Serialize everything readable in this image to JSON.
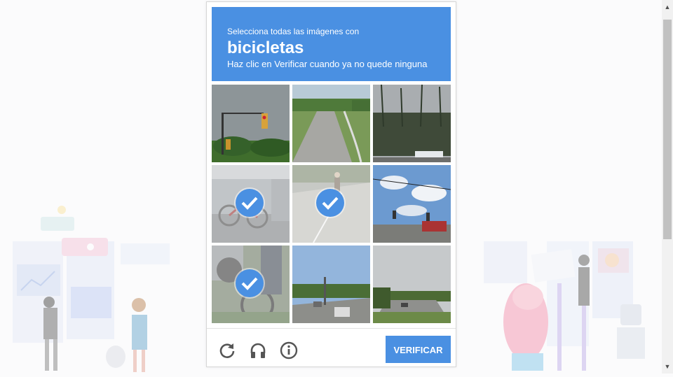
{
  "captcha": {
    "instruction_line1": "Selecciona todas las imágenes con",
    "target_word": "bicicletas",
    "instruction_line3": "Haz clic en Verificar cuando ya no quede ninguna",
    "verify_label": "VERIFICAR",
    "accent_color": "#4a90e2",
    "tiles": [
      {
        "scene": "traffic-light-sky",
        "selected": false
      },
      {
        "scene": "curved-road",
        "selected": false
      },
      {
        "scene": "trees-parking",
        "selected": false
      },
      {
        "scene": "parked-bicycles",
        "selected": true
      },
      {
        "scene": "cyclist-street",
        "selected": true
      },
      {
        "scene": "intersection-clouds",
        "selected": false
      },
      {
        "scene": "bicycle-closeup",
        "selected": true
      },
      {
        "scene": "highway-traffic",
        "selected": false
      },
      {
        "scene": "road-cloudy",
        "selected": false
      }
    ],
    "footer_icons": [
      "reload-icon",
      "audio-headphones-icon",
      "info-icon"
    ]
  }
}
